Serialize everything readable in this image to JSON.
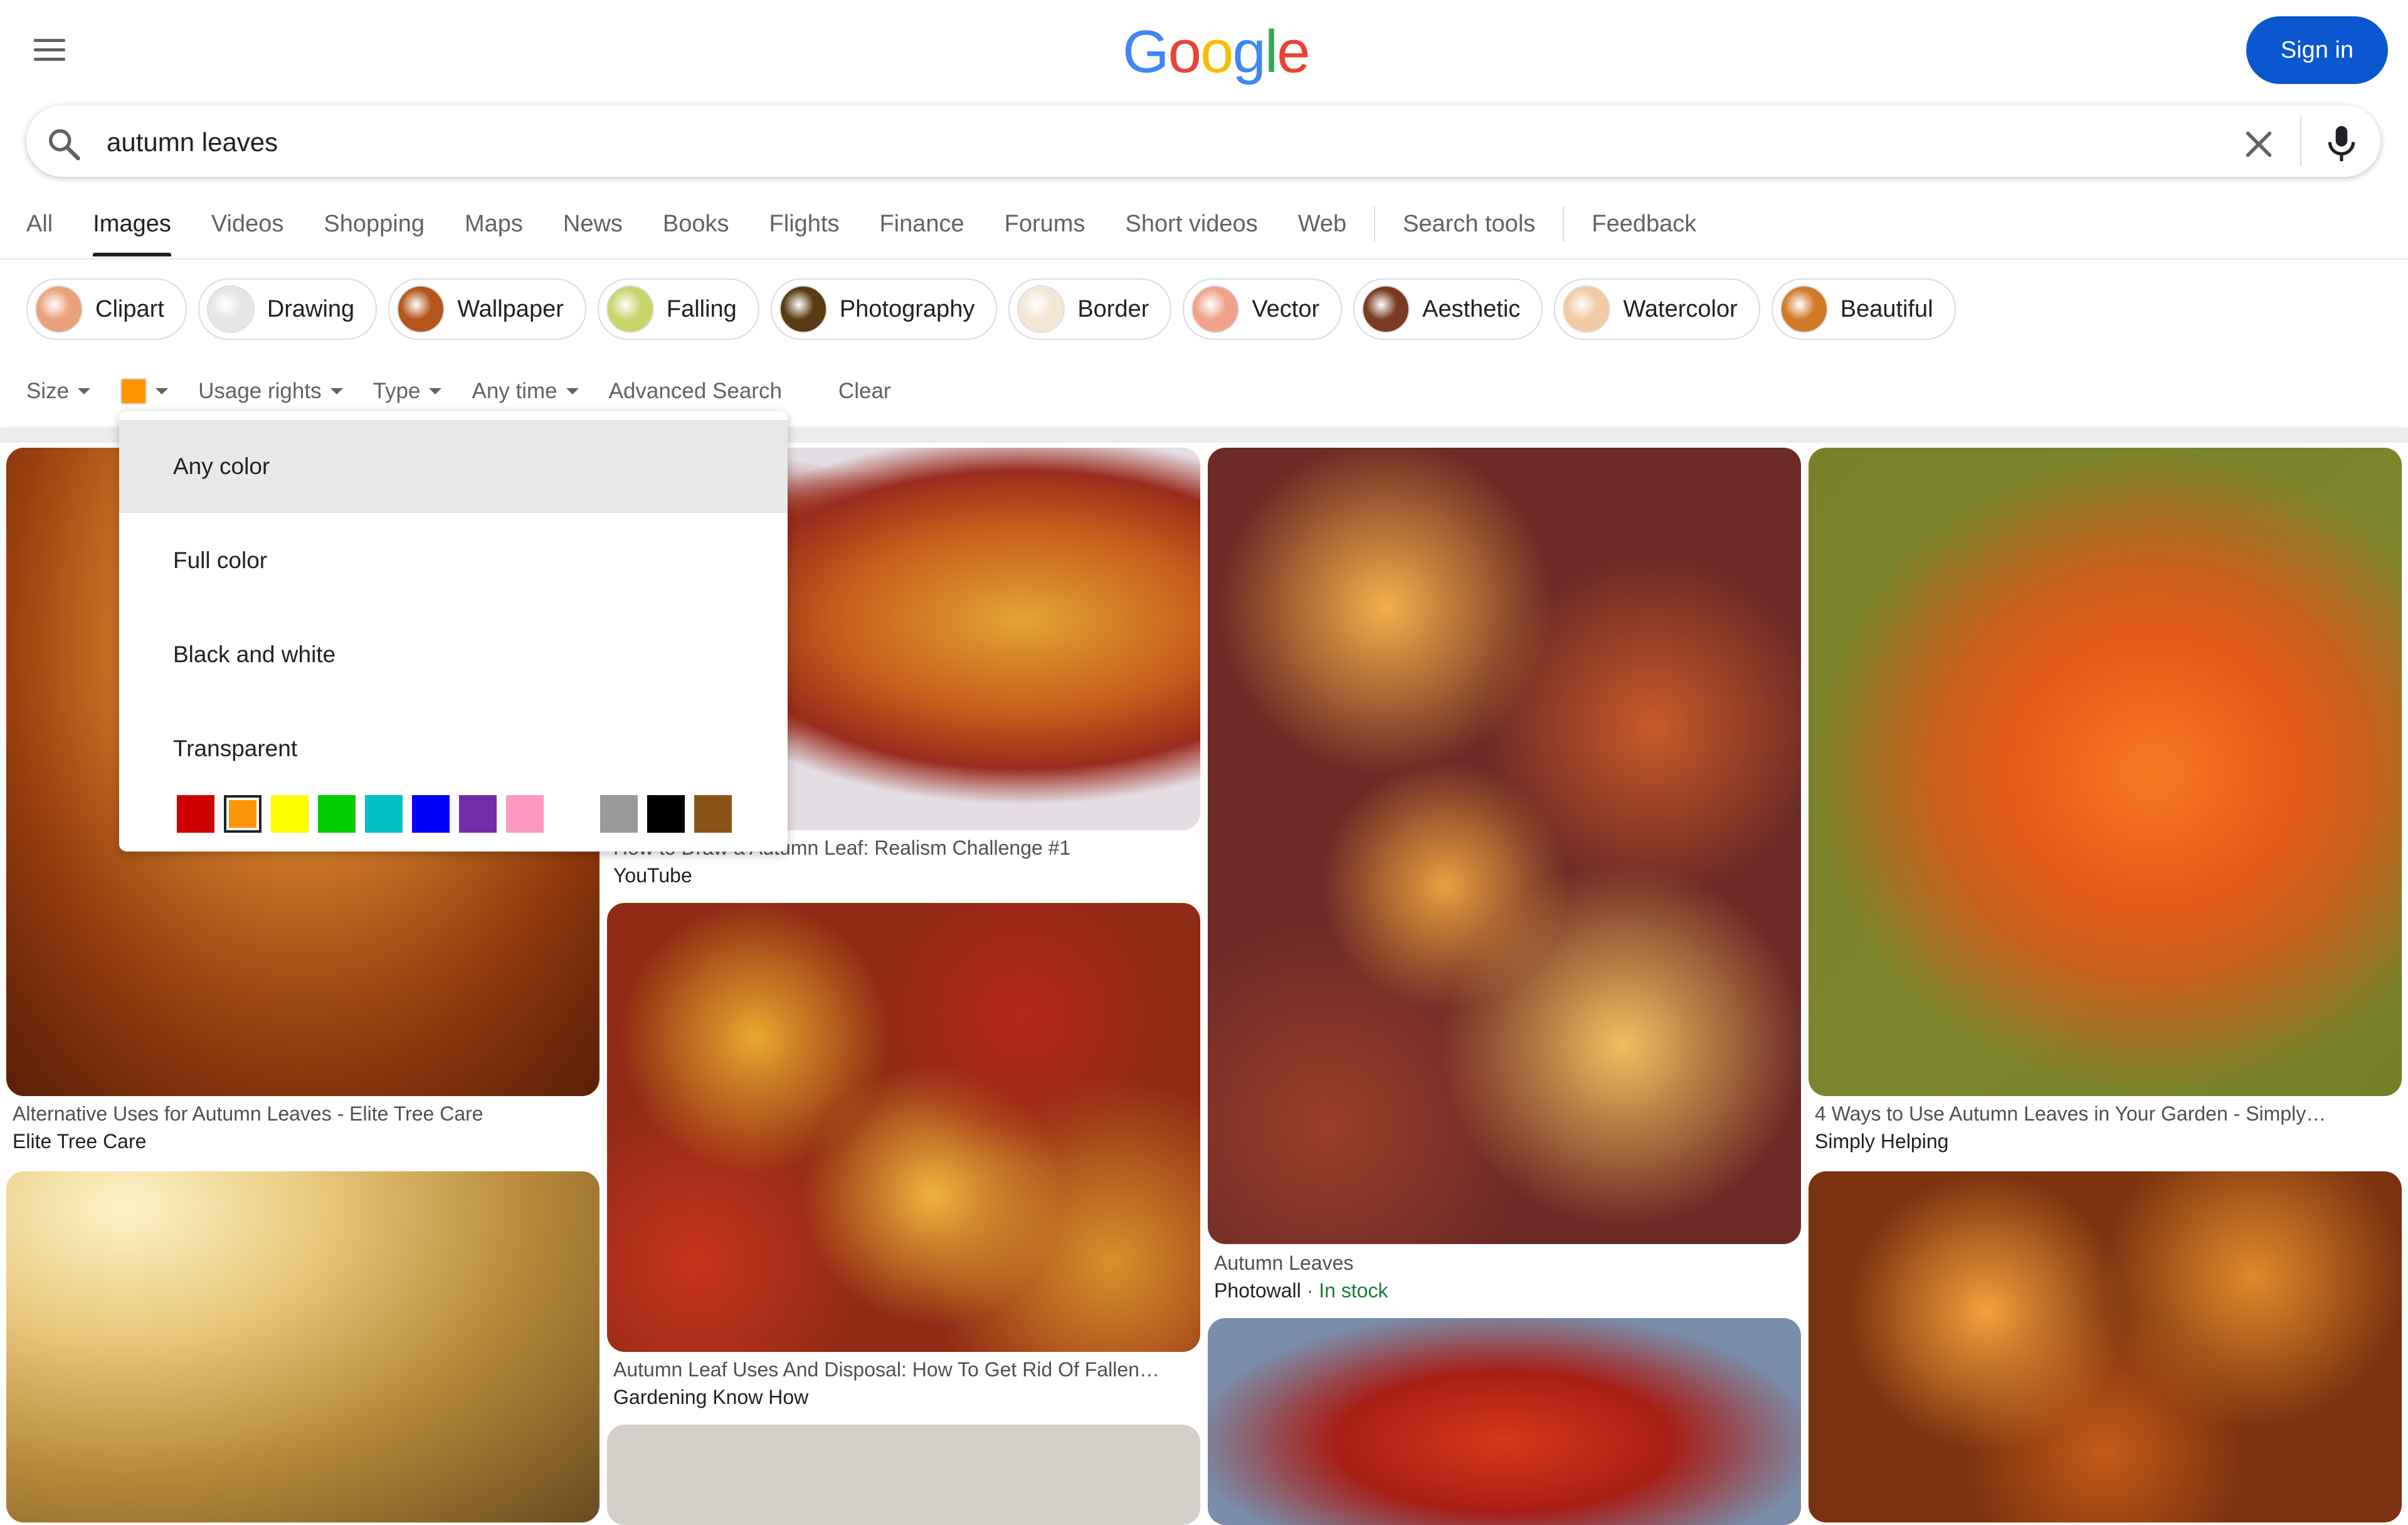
{
  "header": {
    "logo_letters": [
      {
        "char": "G",
        "color": "#4285f4"
      },
      {
        "char": "o",
        "color": "#ea4335"
      },
      {
        "char": "o",
        "color": "#fbbc05"
      },
      {
        "char": "g",
        "color": "#4285f4"
      },
      {
        "char": "l",
        "color": "#34a853"
      },
      {
        "char": "e",
        "color": "#ea4335"
      }
    ],
    "sign_in_label": "Sign in",
    "menu_icon": "hamburger-menu-icon"
  },
  "search": {
    "query": "autumn leaves",
    "icons": [
      "search-icon",
      "clear-icon",
      "microphone-icon"
    ]
  },
  "tabs": [
    {
      "label": "All",
      "active": false
    },
    {
      "label": "Images",
      "active": true
    },
    {
      "label": "Videos",
      "active": false
    },
    {
      "label": "Shopping",
      "active": false
    },
    {
      "label": "Maps",
      "active": false
    },
    {
      "label": "News",
      "active": false
    },
    {
      "label": "Books",
      "active": false
    },
    {
      "label": "Flights",
      "active": false
    },
    {
      "label": "Finance",
      "active": false
    },
    {
      "label": "Forums",
      "active": false
    },
    {
      "label": "Short videos",
      "active": false
    },
    {
      "label": "Web",
      "active": false
    }
  ],
  "tab_tools": [
    "Search tools",
    "Feedback"
  ],
  "chips": [
    {
      "label": "Clipart",
      "thumb": "#e9a27a"
    },
    {
      "label": "Drawing",
      "thumb": "#e6e6e6"
    },
    {
      "label": "Wallpaper",
      "thumb": "#b5551c"
    },
    {
      "label": "Falling",
      "thumb": "#c7d46a"
    },
    {
      "label": "Photography",
      "thumb": "#5a3a12"
    },
    {
      "label": "Border",
      "thumb": "#f4e7d6"
    },
    {
      "label": "Vector",
      "thumb": "#f0a38a"
    },
    {
      "label": "Aesthetic",
      "thumb": "#7a3b22"
    },
    {
      "label": "Watercolor",
      "thumb": "#f2c9a3"
    },
    {
      "label": "Beautiful",
      "thumb": "#d07a2a"
    }
  ],
  "filters": {
    "size": "Size",
    "color_selected": "#ff9500",
    "usage_rights": "Usage rights",
    "type": "Type",
    "time": "Any time",
    "advanced": "Advanced Search",
    "clear": "Clear"
  },
  "color_menu": {
    "options": [
      "Any color",
      "Full color",
      "Black and white",
      "Transparent"
    ],
    "selected_option": "Any color",
    "swatches": [
      "#cc0000",
      "#fb940b",
      "#ffff00",
      "#00cc00",
      "#03c0c6",
      "#0000ff",
      "#762ca7",
      "#ff98bf",
      "#ffffff",
      "#999999",
      "#000000",
      "#885418"
    ],
    "selected_swatch": "#fb940b"
  },
  "results": [
    {
      "title": "Alternative Uses for Autumn Leaves - Elite Tree Care",
      "source": "Elite Tree Care"
    },
    {
      "title": "How to Draw a Autumn Leaf: Realism Challenge #1",
      "source": "YouTube"
    },
    {
      "title": "Autumn Leaves",
      "source": "Photowall",
      "extra": " · In stock"
    },
    {
      "title": "4 Ways to Use Autumn Leaves in Your Garden - Simply…",
      "source": "Simply Helping"
    },
    {
      "title": "Autumn Leaf Uses And Disposal: How To Get Rid Of Fallen…",
      "source": "Gardening Know How"
    }
  ]
}
